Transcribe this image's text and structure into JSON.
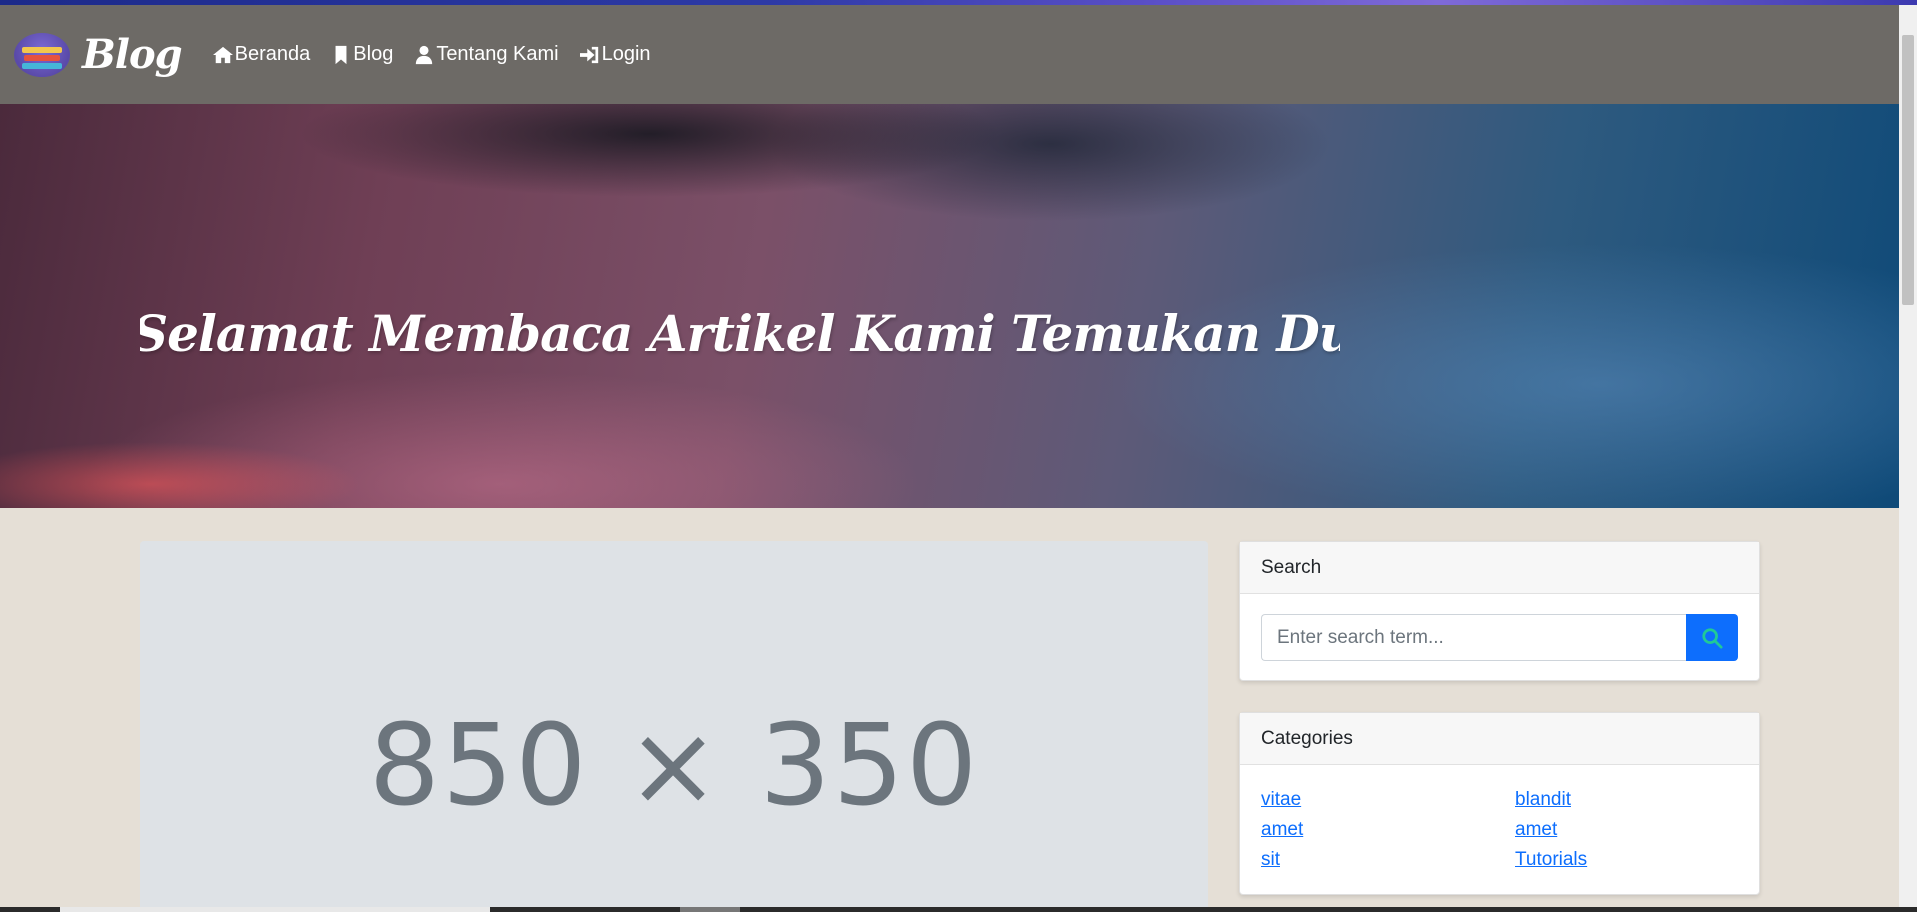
{
  "navbar": {
    "brand": "Blog",
    "links": [
      {
        "label": "Beranda",
        "icon": "home-icon"
      },
      {
        "label": "Blog",
        "icon": "bookmark-icon"
      },
      {
        "label": "Tentang Kami",
        "icon": "user-icon"
      },
      {
        "label": "Login",
        "icon": "login-icon"
      }
    ]
  },
  "hero": {
    "title": "Selamat Membaca Artikel Kami Temukan Dunia Baru"
  },
  "post": {
    "image_placeholder": "850 × 350"
  },
  "search": {
    "header": "Search",
    "placeholder": "Enter search term...",
    "button_icon": "search-icon"
  },
  "categories": {
    "header": "Categories",
    "items": [
      "vitae",
      "blandit",
      "amet",
      "amet",
      "sit",
      "Tutorials"
    ]
  },
  "colors": {
    "navbar": "#6d6a66",
    "page_background": "#e5dfd6",
    "primary": "#0d6efd",
    "search_icon": "#20c997"
  }
}
